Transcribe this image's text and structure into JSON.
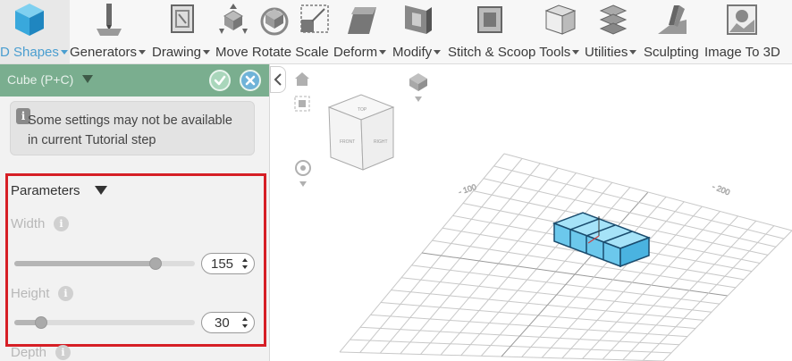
{
  "toolbar": {
    "items": [
      {
        "label": "D Shapes",
        "has_dropdown": true,
        "active": true
      },
      {
        "label": "Generators",
        "has_dropdown": true
      },
      {
        "label": "Drawing",
        "has_dropdown": true
      },
      {
        "label": "Move Rotate Scale",
        "has_dropdown": false
      },
      {
        "label": "Deform",
        "has_dropdown": true
      },
      {
        "label": "Modify",
        "has_dropdown": true
      },
      {
        "label": "Stitch & Scoop Tools",
        "has_dropdown": true
      },
      {
        "label": "Utilities",
        "has_dropdown": true
      },
      {
        "label": "Sculpting",
        "has_dropdown": false
      },
      {
        "label": "Image To 3D",
        "has_dropdown": false
      }
    ],
    "accent_color": "#4a9ed0"
  },
  "panel": {
    "title": "Cube (P+C)",
    "header_color": "#7aae8f",
    "confirm_icon": "check-icon",
    "cancel_icon": "close-icon",
    "notice": {
      "icon": "info-icon",
      "icon_glyph": "i",
      "text": "Some settings may not be available in current Tutorial step"
    },
    "parameters": {
      "title": "Parameters",
      "highlight_color": "#d61f26",
      "fields": [
        {
          "label": "Width",
          "value": "155",
          "slider_fraction": 0.78
        },
        {
          "label": "Height",
          "value": "30",
          "slider_fraction": 0.15
        },
        {
          "label": "Depth"
        }
      ]
    }
  },
  "viewport": {
    "view_cube_faces": [
      "TOP",
      "FRONT",
      "RIGHT"
    ],
    "axis_labels": [
      "- 100",
      "- 200"
    ],
    "object_color": "#6cc8ec"
  }
}
